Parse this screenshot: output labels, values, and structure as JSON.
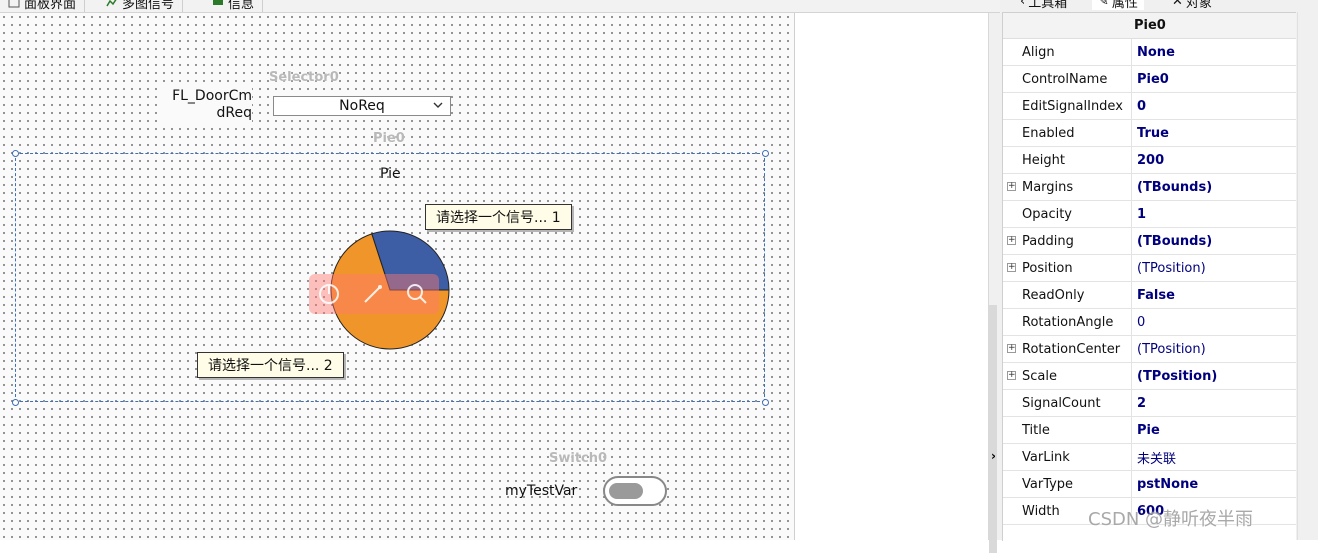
{
  "editor_tabs": [
    "面板界面",
    "多图信号",
    "信息"
  ],
  "canvas": {
    "selector": {
      "control_name": "Selector0",
      "caption": "FL_DoorCmdReq",
      "caption_line1": "FL_DoorCm",
      "caption_line2": "dReq",
      "value": "NoReq"
    },
    "pie": {
      "control_name": "Pie0",
      "title": "Pie",
      "signal_1_label": "请选择一个信号... 1",
      "signal_2_label": "请选择一个信号... 2"
    },
    "switch": {
      "control_name": "Switch0",
      "caption": "myTestVar"
    }
  },
  "chart_data": {
    "type": "pie",
    "title": "Pie",
    "labels": [
      "请选择一个信号... 1",
      "请选择一个信号... 2"
    ],
    "values": [
      30,
      70
    ],
    "colors": [
      "#3d5ea5",
      "#f0952a"
    ]
  },
  "right_panel": {
    "tabs": [
      "工具箱",
      "属性",
      "对象"
    ],
    "object_name": "Pie0",
    "properties": [
      {
        "name": "Align",
        "value": "None",
        "bold": true,
        "expandable": false
      },
      {
        "name": "ControlName",
        "value": "Pie0",
        "bold": true,
        "expandable": false
      },
      {
        "name": "EditSignalIndex",
        "value": "0",
        "bold": true,
        "expandable": false
      },
      {
        "name": "Enabled",
        "value": "True",
        "bold": true,
        "expandable": false
      },
      {
        "name": "Height",
        "value": "200",
        "bold": true,
        "expandable": false
      },
      {
        "name": "Margins",
        "value": "(TBounds)",
        "bold": true,
        "expandable": true
      },
      {
        "name": "Opacity",
        "value": "1",
        "bold": true,
        "expandable": false
      },
      {
        "name": "Padding",
        "value": "(TBounds)",
        "bold": true,
        "expandable": true
      },
      {
        "name": "Position",
        "value": "(TPosition)",
        "bold": false,
        "expandable": true
      },
      {
        "name": "ReadOnly",
        "value": "False",
        "bold": true,
        "expandable": false
      },
      {
        "name": "RotationAngle",
        "value": "0",
        "bold": false,
        "expandable": false
      },
      {
        "name": "RotationCenter",
        "value": "(TPosition)",
        "bold": false,
        "expandable": true
      },
      {
        "name": "Scale",
        "value": "(TPosition)",
        "bold": true,
        "expandable": true
      },
      {
        "name": "SignalCount",
        "value": "2",
        "bold": true,
        "expandable": false
      },
      {
        "name": "Title",
        "value": "Pie",
        "bold": true,
        "expandable": false
      },
      {
        "name": "VarLink",
        "value": "未关联",
        "bold": false,
        "expandable": false
      },
      {
        "name": "VarType",
        "value": "pstNone",
        "bold": true,
        "expandable": false
      },
      {
        "name": "Width",
        "value": "600",
        "bold": true,
        "expandable": false
      }
    ]
  },
  "watermark": "CSDN @静听夜半雨"
}
